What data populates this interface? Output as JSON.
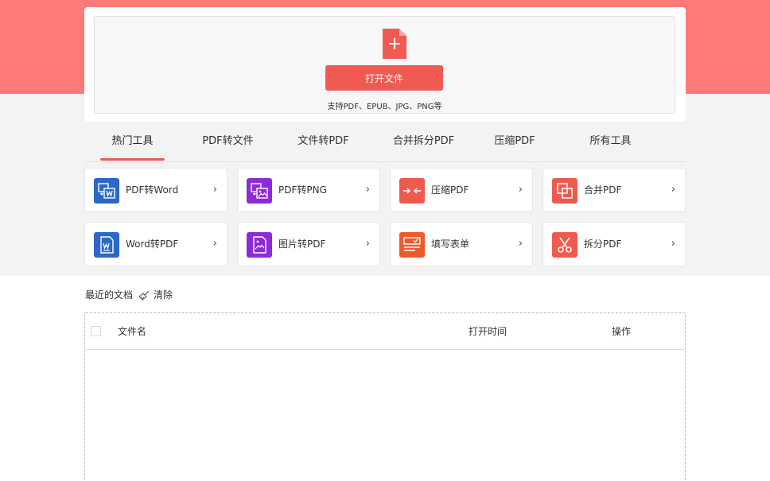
{
  "upload": {
    "button_label": "打开文件",
    "support_text": "支持PDF、EPUB、JPG、PNG等"
  },
  "tabs": [
    {
      "label": "热门工具",
      "active": true
    },
    {
      "label": "PDF转文件"
    },
    {
      "label": "文件转PDF"
    },
    {
      "label": "合并拆分PDF"
    },
    {
      "label": "压缩PDF"
    },
    {
      "label": "所有工具"
    }
  ],
  "tools": [
    {
      "label": "PDF转Word",
      "icon": "pdf-to-word-icon",
      "color": "#2b68c8"
    },
    {
      "label": "PDF转PNG",
      "icon": "pdf-to-png-icon",
      "color": "#8e2bd8"
    },
    {
      "label": "压缩PDF",
      "icon": "compress-icon",
      "color": "#ef5a4f"
    },
    {
      "label": "合并PDF",
      "icon": "merge-icon",
      "color": "#ef5a4f"
    },
    {
      "label": "Word转PDF",
      "icon": "word-to-pdf-icon",
      "color": "#2b68c8"
    },
    {
      "label": "图片转PDF",
      "icon": "image-to-pdf-icon",
      "color": "#8e2bd8"
    },
    {
      "label": "填写表单",
      "icon": "form-icon",
      "color": "#f05a2a"
    },
    {
      "label": "拆分PDF",
      "icon": "scissors-icon",
      "color": "#ef5a4f"
    }
  ],
  "chevron": "›",
  "recent": {
    "title": "最近的文档",
    "clear_label": "清除"
  },
  "table": {
    "columns": [
      "文件名",
      "打开时间",
      "操作"
    ]
  },
  "colors": {
    "brand": "#f05a52",
    "header_bg": "#fd7a78"
  }
}
